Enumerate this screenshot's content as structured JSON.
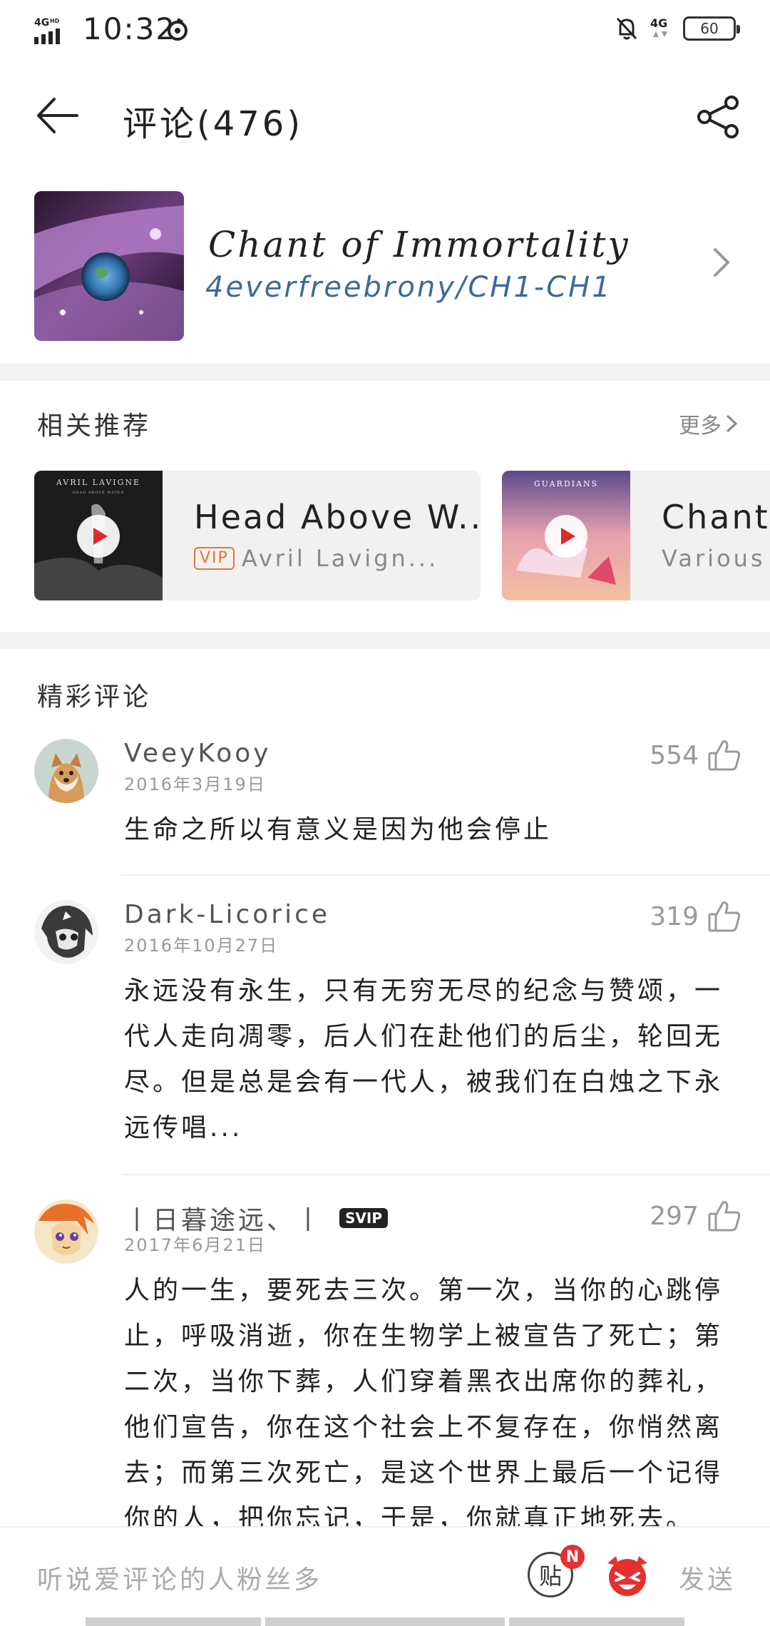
{
  "status_bar": {
    "network": "4GHD",
    "time": "10:32",
    "network_right": "4G",
    "battery": "60"
  },
  "header": {
    "title": "评论(476)"
  },
  "song": {
    "title": "Chant of Immortality",
    "artist": "4everfreebrony/CH1-CH1"
  },
  "related": {
    "title": "相关推荐",
    "more": "更多",
    "items": [
      {
        "title": "Head Above W...",
        "vip": "VIP",
        "artist": "Avril Lavign...",
        "cover_text": "AVRIL LAVIGNE",
        "cover_sub": "HEAD ABOVE WATER"
      },
      {
        "title": "Chant",
        "artist": "Various",
        "cover_text": "GUARDIANS"
      }
    ]
  },
  "comments_section": {
    "title": "精彩评论",
    "comments": [
      {
        "user": "VeeyKooy",
        "date": "2016年3月19日",
        "likes": "554",
        "text": "生命之所以有意义是因为他会停止"
      },
      {
        "user": "Dark-Licorice",
        "date": "2016年10月27日",
        "likes": "319",
        "text": "永远没有永生，只有无穷无尽的纪念与赞颂，一代人走向凋零，后人们在赴他们的后尘，轮回无尽。但是总是会有一代人，被我们在白烛之下永远传唱..."
      },
      {
        "user": "丨日暮途远、丨",
        "badge": "SVIP",
        "date": "2017年6月21日",
        "likes": "297",
        "text": "人的一生，要死去三次。第一次，当你的心跳停止，呼吸消逝，你在生物学上被宣告了死亡；第二次，当你下葬，人们穿着黑衣出席你的葬礼，他们宣告，你在这个社会上不复存在，你悄然离去；而第三次死亡，是这个世界上最后一个记得你的人，把你忘记，于是，你就真正地死去。"
      }
    ]
  },
  "bottom_bar": {
    "placeholder": "听说爱评论的人粉丝多",
    "tie_label": "贴",
    "notif_badge": "N",
    "send": "发送"
  },
  "colors": {
    "accent_link": "#3a6a9c",
    "vip_orange": "#e8772e",
    "badge_red": "#e53030",
    "play_red": "#e02828"
  }
}
